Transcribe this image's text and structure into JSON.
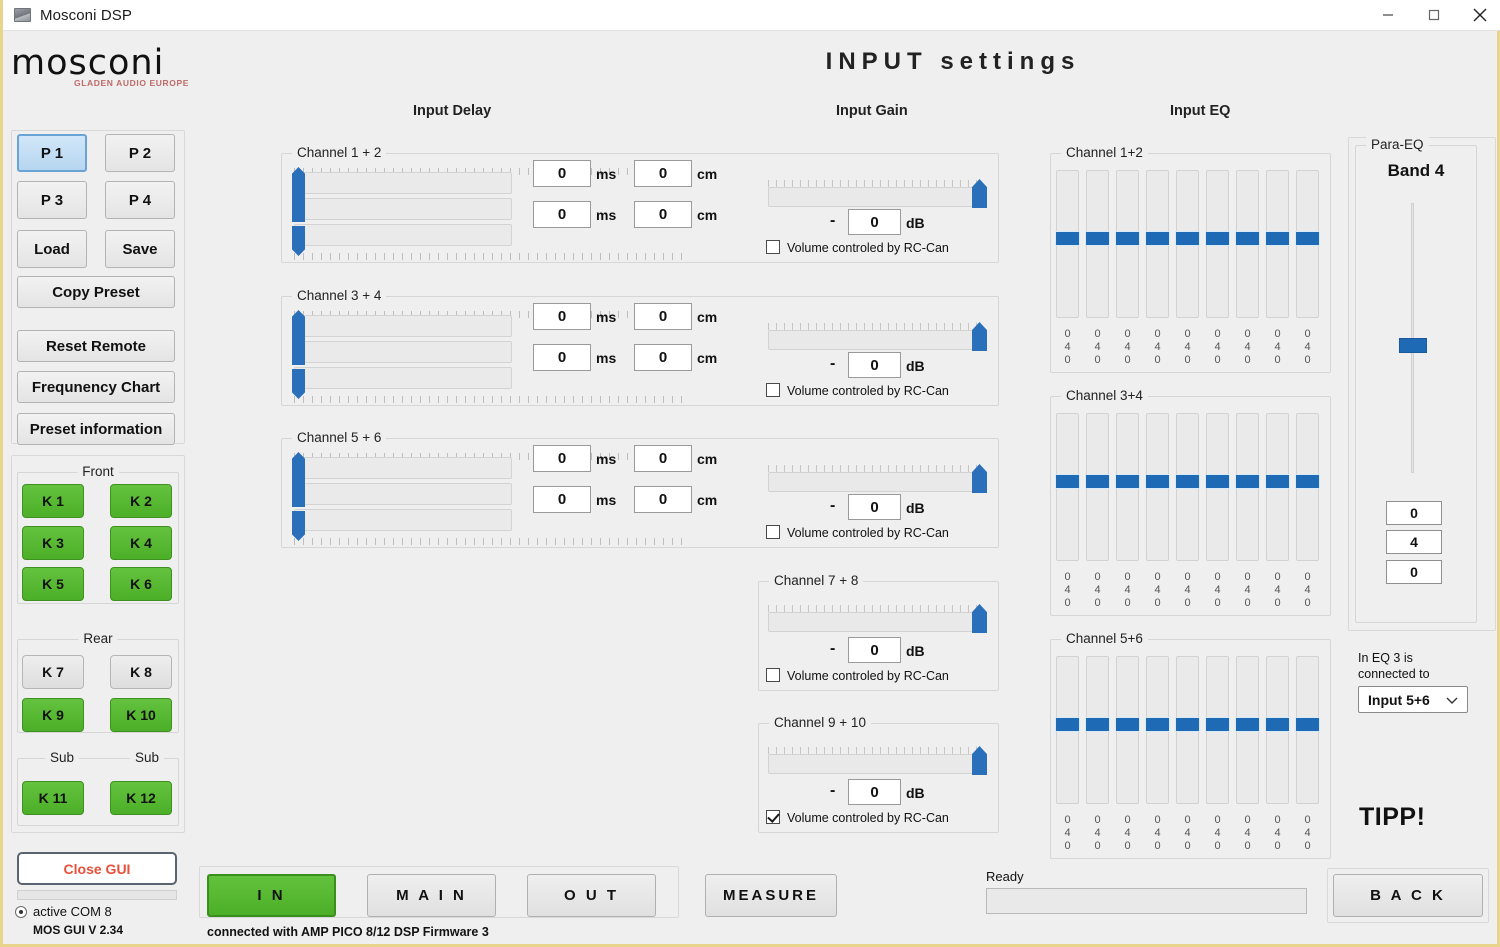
{
  "window": {
    "title": "Mosconi DSP",
    "icon": "app-icon",
    "controls": {
      "minimize": "minimize-icon",
      "maximize": "maximize-icon",
      "close": "close-icon"
    }
  },
  "logo": {
    "word": "mosconi",
    "tagline": "GLADEN AUDIO EUROPE"
  },
  "header": {
    "main_title": "INPUT  settings",
    "columns": [
      "Input Delay",
      "Input Gain",
      "Input EQ"
    ]
  },
  "sidebar": {
    "presets": [
      {
        "label": "P 1",
        "selected": true
      },
      {
        "label": "P 2",
        "selected": false
      },
      {
        "label": "P 3",
        "selected": false
      },
      {
        "label": "P 4",
        "selected": false
      }
    ],
    "file_buttons": [
      {
        "label": "Load"
      },
      {
        "label": "Save"
      }
    ],
    "actions": [
      {
        "label": "Copy Preset"
      },
      {
        "label": "Reset Remote"
      },
      {
        "label": "Frequnency Chart"
      },
      {
        "label": "Preset information"
      }
    ],
    "speaker_groups": [
      {
        "title": "Front",
        "buttons": [
          {
            "label": "K 1",
            "active": true
          },
          {
            "label": "K 2",
            "active": true
          },
          {
            "label": "K 3",
            "active": true
          },
          {
            "label": "K 4",
            "active": true
          },
          {
            "label": "K 5",
            "active": true
          },
          {
            "label": "K 6",
            "active": true
          }
        ]
      },
      {
        "title": "Rear",
        "buttons": [
          {
            "label": "K 7",
            "active": false
          },
          {
            "label": "K 8",
            "active": false
          },
          {
            "label": "K 9",
            "active": true
          },
          {
            "label": "K 10",
            "active": true
          }
        ]
      },
      {
        "title": "Sub",
        "title2": "Sub",
        "buttons": [
          {
            "label": "K 11",
            "active": true
          },
          {
            "label": "K 12",
            "active": true
          }
        ]
      }
    ],
    "close_gui": "Close GUI",
    "com_status": "active COM 8",
    "version": "MOS GUI V 2.34"
  },
  "input_delay": {
    "channels": [
      {
        "title": "Channel 1 + 2",
        "rows": [
          {
            "ms": "0",
            "ms_unit": "ms",
            "cm": "0",
            "cm_unit": "cm"
          },
          {
            "ms": "0",
            "ms_unit": "ms",
            "cm": "0",
            "cm_unit": "cm"
          }
        ]
      },
      {
        "title": "Channel 3 + 4",
        "rows": [
          {
            "ms": "0",
            "ms_unit": "ms",
            "cm": "0",
            "cm_unit": "cm"
          },
          {
            "ms": "0",
            "ms_unit": "ms",
            "cm": "0",
            "cm_unit": "cm"
          }
        ]
      },
      {
        "title": "Channel 5 + 6",
        "rows": [
          {
            "ms": "0",
            "ms_unit": "ms",
            "cm": "0",
            "cm_unit": "cm"
          },
          {
            "ms": "0",
            "ms_unit": "ms",
            "cm": "0",
            "cm_unit": "cm"
          }
        ]
      }
    ]
  },
  "input_gain": {
    "channels": [
      {
        "title": "Channel 1 + 2",
        "minus": "-",
        "value": "0",
        "unit": "dB",
        "checkbox_label": "Volume controled by RC-Can",
        "checked": false,
        "slider_pct": 100
      },
      {
        "title": "Channel 3 + 4",
        "minus": "-",
        "value": "0",
        "unit": "dB",
        "checkbox_label": "Volume controled by RC-Can",
        "checked": false,
        "slider_pct": 100
      },
      {
        "title": "Channel 5 + 6",
        "minus": "-",
        "value": "0",
        "unit": "dB",
        "checkbox_label": "Volume controled by RC-Can",
        "checked": false,
        "slider_pct": 100
      },
      {
        "title": "Channel 7 + 8",
        "minus": "-",
        "value": "0",
        "unit": "dB",
        "checkbox_label": "Volume controled by RC-Can",
        "checked": false,
        "slider_pct": 100
      },
      {
        "title": "Channel 9 + 10",
        "minus": "-",
        "value": "0",
        "unit": "dB",
        "checkbox_label": "Volume controled by RC-Can",
        "checked": true,
        "slider_pct": 100
      }
    ]
  },
  "input_eq": {
    "sections": [
      {
        "title": "Channel 1+2",
        "bands": [
          {
            "v": [
              "0",
              "4",
              "0"
            ]
          },
          {
            "v": [
              "0",
              "4",
              "0"
            ]
          },
          {
            "v": [
              "0",
              "4",
              "0"
            ]
          },
          {
            "v": [
              "0",
              "4",
              "0"
            ]
          },
          {
            "v": [
              "0",
              "4",
              "0"
            ]
          },
          {
            "v": [
              "0",
              "4",
              "0"
            ]
          },
          {
            "v": [
              "0",
              "4",
              "0"
            ]
          },
          {
            "v": [
              "0",
              "4",
              "0"
            ]
          },
          {
            "v": [
              "0",
              "4",
              "0"
            ]
          }
        ]
      },
      {
        "title": "Channel 3+4",
        "bands": [
          {
            "v": [
              "0",
              "4",
              "0"
            ]
          },
          {
            "v": [
              "0",
              "4",
              "0"
            ]
          },
          {
            "v": [
              "0",
              "4",
              "0"
            ]
          },
          {
            "v": [
              "0",
              "4",
              "0"
            ]
          },
          {
            "v": [
              "0",
              "4",
              "0"
            ]
          },
          {
            "v": [
              "0",
              "4",
              "0"
            ]
          },
          {
            "v": [
              "0",
              "4",
              "0"
            ]
          },
          {
            "v": [
              "0",
              "4",
              "0"
            ]
          },
          {
            "v": [
              "0",
              "4",
              "0"
            ]
          }
        ]
      },
      {
        "title": "Channel 5+6",
        "bands": [
          {
            "v": [
              "0",
              "4",
              "0"
            ]
          },
          {
            "v": [
              "0",
              "4",
              "0"
            ]
          },
          {
            "v": [
              "0",
              "4",
              "0"
            ]
          },
          {
            "v": [
              "0",
              "4",
              "0"
            ]
          },
          {
            "v": [
              "0",
              "4",
              "0"
            ]
          },
          {
            "v": [
              "0",
              "4",
              "0"
            ]
          },
          {
            "v": [
              "0",
              "4",
              "0"
            ]
          },
          {
            "v": [
              "0",
              "4",
              "0"
            ]
          },
          {
            "v": [
              "0",
              "4",
              "0"
            ]
          }
        ]
      }
    ]
  },
  "para_eq": {
    "group_title": "Para-EQ",
    "band_label": "Band 4",
    "fields": [
      "0",
      "4",
      "0"
    ],
    "connection_note": "In EQ 3 is\nconnected to",
    "connection_note_line1": "In EQ 3 is",
    "connection_note_line2": "connected to",
    "dropdown_value": "Input 5+6",
    "tipp": "TIPP!"
  },
  "bottom": {
    "nav": [
      {
        "label": "I N",
        "active": true
      },
      {
        "label": "M A I N",
        "active": false
      },
      {
        "label": "O U T",
        "active": false
      }
    ],
    "measure": "MEASURE",
    "back": "B A C K",
    "ready_label": "Ready",
    "connection": "connected with AMP PICO 8/12 DSP Firmware 3"
  },
  "colors": {
    "accent_blue": "#1f6ab4",
    "active_green": "#4caf28",
    "close_red": "#e8503a",
    "frame_yellow": "#e8d48a",
    "panel_bg": "#efefef"
  }
}
